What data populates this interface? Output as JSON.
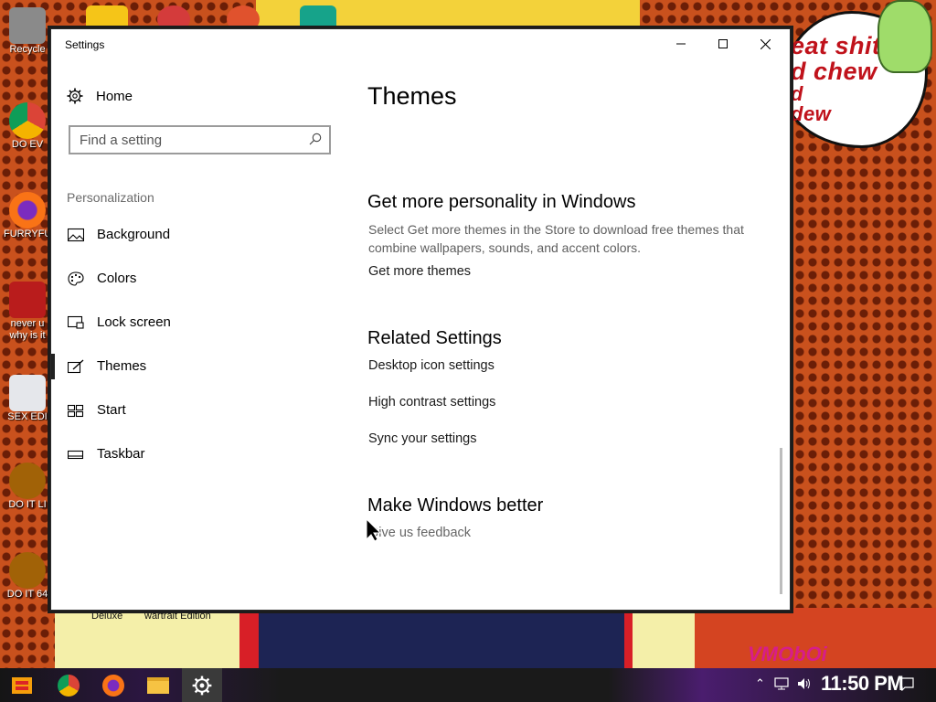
{
  "window": {
    "title": "Settings",
    "minimize_icon": "minimize-icon",
    "maximize_icon": "maximize-icon",
    "close_icon": "close-icon"
  },
  "sidebar": {
    "home_label": "Home",
    "search_placeholder": "Find a setting",
    "section_header": "Personalization",
    "items": [
      {
        "label": "Background",
        "icon": "picture-icon"
      },
      {
        "label": "Colors",
        "icon": "palette-icon"
      },
      {
        "label": "Lock screen",
        "icon": "lock-screen-icon"
      },
      {
        "label": "Themes",
        "icon": "themes-icon",
        "selected": true
      },
      {
        "label": "Start",
        "icon": "start-icon"
      },
      {
        "label": "Taskbar",
        "icon": "taskbar-icon"
      }
    ]
  },
  "main": {
    "page_title": "Themes",
    "personality": {
      "heading": "Get more personality in Windows",
      "description": "Select Get more themes in the Store to download free themes that combine wallpapers, sounds, and accent colors.",
      "link": "Get more themes"
    },
    "related": {
      "heading": "Related Settings",
      "links": [
        "Desktop icon settings",
        "High contrast settings",
        "Sync your settings"
      ]
    },
    "better": {
      "heading": "Make Windows better",
      "link": "Give us feedback"
    }
  },
  "desktop": {
    "icons": [
      {
        "label": "Recycle",
        "color": "#c0c0c0"
      },
      {
        "label": "DO EV",
        "color": "#3b82f6"
      },
      {
        "label": "FURRYFU",
        "color": "#f97316"
      },
      {
        "label": "never u",
        "sublabel": "why is it",
        "color": "#b91c1c"
      },
      {
        "label": "SEX EDI",
        "color": "#e5e7eb"
      },
      {
        "label": "DO IT LI",
        "color": "#a16207"
      },
      {
        "label": "DO IT 64",
        "color": "#a16207"
      }
    ],
    "wallpaper_text": [
      "eat shit",
      "d chew",
      "d",
      "dew"
    ],
    "bottom_labels": [
      "Deluxe",
      "wartrait Edition"
    ],
    "signature": "VMObOi"
  },
  "taskbar": {
    "clock": "11:50 PM",
    "apps": [
      "start-icon",
      "chrome-icon",
      "firefox-icon",
      "file-explorer-icon",
      "settings-icon"
    ]
  },
  "colors": {
    "accent": "#000000",
    "link": "#1a1a1a",
    "desc": "#5f5f5f",
    "window_bg": "#ffffff"
  }
}
